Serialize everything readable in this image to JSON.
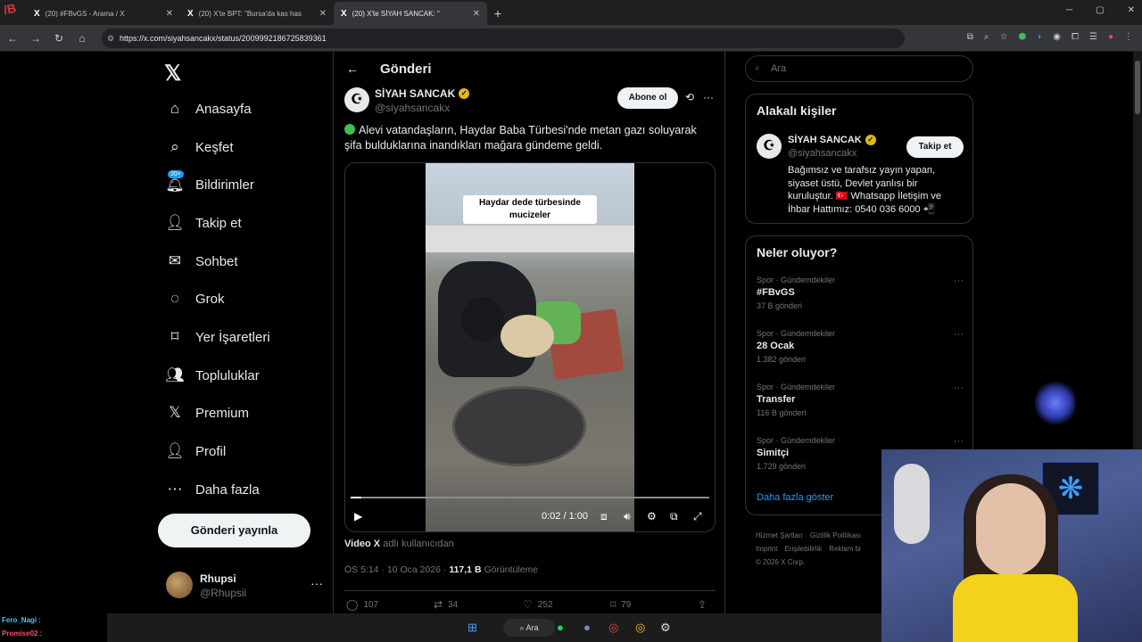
{
  "browser": {
    "tabs": [
      {
        "label": "(20) #FBvGS - Arama / X",
        "active": false
      },
      {
        "label": "(20) X'te BPT: \"Bursa'da kas has",
        "active": false
      },
      {
        "label": "(20) X'te SİYAH SANCAK: \"",
        "active": true
      }
    ],
    "url": "https://x.com/siyahsancakx/status/2009992186725839361"
  },
  "sidebar": {
    "badge": "20+",
    "items": [
      {
        "label": "Anasayfa",
        "icon": "home-icon"
      },
      {
        "label": "Keşfet",
        "icon": "search-icon"
      },
      {
        "label": "Bildirimler",
        "icon": "bell-icon"
      },
      {
        "label": "Takip et",
        "icon": "add-person-icon"
      },
      {
        "label": "Sohbet",
        "icon": "mail-icon"
      },
      {
        "label": "Grok",
        "icon": "grok-icon"
      },
      {
        "label": "Yer İşaretleri",
        "icon": "bookmark-icon"
      },
      {
        "label": "Topluluklar",
        "icon": "communities-icon"
      },
      {
        "label": "Premium",
        "icon": "x-icon"
      },
      {
        "label": "Profil",
        "icon": "person-icon"
      },
      {
        "label": "Daha fazla",
        "icon": "more-circle-icon"
      }
    ],
    "post_button": "Gönderi yayınla",
    "account": {
      "name": "Rhupsi",
      "handle": "@Rhupsii"
    }
  },
  "main": {
    "header": "Gönderi",
    "author": {
      "name": "SİYAH SANCAK",
      "handle": "@siyahsancakx"
    },
    "subscribe": "Abone ol",
    "text": "Alevi vatandaşların, Haydar Baba Türbesi'nde metan gazı soluyarak şifa bulduklarına inandıkları mağara gündeme geldi.",
    "video": {
      "caption": "Haydar dede türbesinde mucizeler",
      "time": "0:02 / 1:00",
      "progress": 0.03
    },
    "video_by_name": "Video X",
    "video_by_suffix": "adlı kullanıcıdan",
    "meta_time": "ÖS 5:14 · 10 Oca 2026 · ",
    "meta_views": "117,1 B",
    "meta_views_label": " Görüntüleme",
    "actions": {
      "replies": "107",
      "reposts": "34",
      "likes": "252",
      "bookmarks": "79"
    }
  },
  "right": {
    "search_placeholder": "Ara",
    "related_title": "Alakalı kişiler",
    "related": {
      "name": "SİYAH SANCAK",
      "handle": "@siyahsancakx",
      "follow": "Takip et",
      "bio": "Bağımsız ve tarafsız yayın yapan, siyaset üstü, Devlet yanlısı bir kuruluştur. 🇹🇷 Whatsapp İletişim ve İhbar Hattımız: 0540 036 6000 📲"
    },
    "trends_title": "Neler oluyor?",
    "trends": [
      {
        "category": "Spor · Gündemdekiler",
        "title": "#FBvGS",
        "count": "37 B gönderi"
      },
      {
        "category": "Spor · Gündemdekiler",
        "title": "28 Ocak",
        "count": "1.382 gönderi"
      },
      {
        "category": "Spor · Gündemdekiler",
        "title": "Transfer",
        "count": "116 B gönderi"
      },
      {
        "category": "Spor · Gündemdekiler",
        "title": "Simitçi",
        "count": "1.729 gönderi"
      }
    ],
    "show_more": "Daha fazla göster",
    "footer": {
      "links1": [
        "Hizmet Şartları",
        "Gizlilik Politikası"
      ],
      "links2": [
        "Imprint",
        "Erişilebilirlik",
        "Reklam bi"
      ],
      "copyright": "© 2026 X Corp."
    }
  },
  "chat": [
    {
      "user": "Fero_Nagi",
      "msg": ":"
    },
    {
      "user": "Promise02",
      "msg": ":"
    }
  ],
  "taskbar": {
    "search": "Ara"
  }
}
